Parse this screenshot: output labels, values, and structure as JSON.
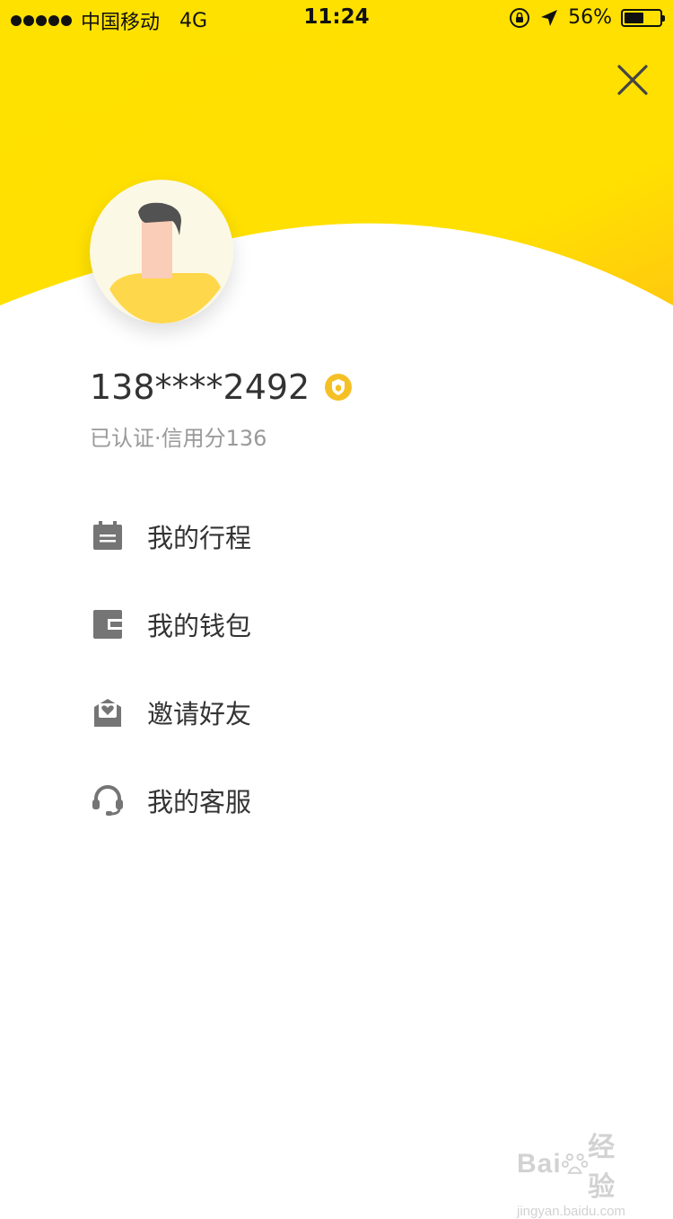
{
  "status_bar": {
    "carrier": "中国移动",
    "network": "4G",
    "time": "11:24",
    "battery_percent": "56%",
    "battery_level": 0.56
  },
  "profile": {
    "phone_masked": "138****2492",
    "certification": "已认证·信用分136"
  },
  "menu": {
    "items": [
      {
        "label": "我的行程",
        "icon": "trip-list-icon"
      },
      {
        "label": "我的钱包",
        "icon": "wallet-icon"
      },
      {
        "label": "邀请好友",
        "icon": "invite-heart-icon"
      },
      {
        "label": "我的客服",
        "icon": "headset-icon"
      }
    ]
  },
  "watermark": {
    "brand_latin": "Bai",
    "brand_suffix": "经验",
    "url": "jingyan.baidu.com"
  },
  "colors": {
    "accent_yellow": "#FFE100",
    "icon_gray": "#757575",
    "badge_gold": "#F5C025"
  }
}
